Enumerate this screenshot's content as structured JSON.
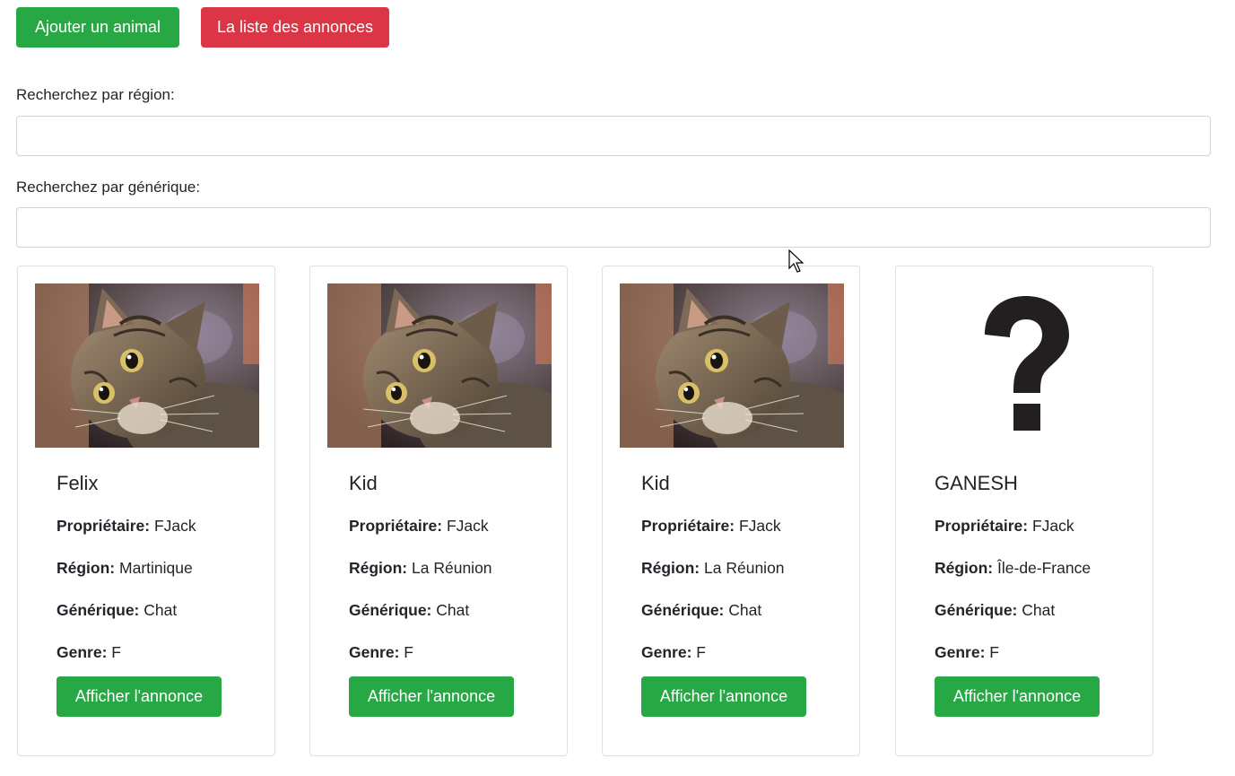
{
  "toolbar": {
    "add_animal_label": "Ajouter un animal",
    "ads_list_label": "La liste des annonces"
  },
  "search": {
    "region_label": "Recherchez par région:",
    "region_value": "",
    "generic_label": "Recherchez par générique:",
    "generic_value": ""
  },
  "labels": {
    "owner": "Propriétaire:",
    "region": "Région:",
    "generic": "Générique:",
    "gender": "Genre:",
    "show_button": "Afficher l'annonce"
  },
  "cards": [
    {
      "name": "Felix",
      "owner": "FJack",
      "region": "Martinique",
      "generic": "Chat",
      "gender": "F",
      "image": "cat-photo"
    },
    {
      "name": "Kid",
      "owner": "FJack",
      "region": "La Réunion",
      "generic": "Chat",
      "gender": "F",
      "image": "cat-photo"
    },
    {
      "name": "Kid",
      "owner": "FJack",
      "region": "La Réunion",
      "generic": "Chat",
      "gender": "F",
      "image": "cat-photo"
    },
    {
      "name": "GANESH",
      "owner": "FJack",
      "region": "Île-de-France",
      "generic": "Chat",
      "gender": "F",
      "image": "question-mark"
    }
  ],
  "colors": {
    "success": "#28a745",
    "danger": "#dc3545"
  }
}
